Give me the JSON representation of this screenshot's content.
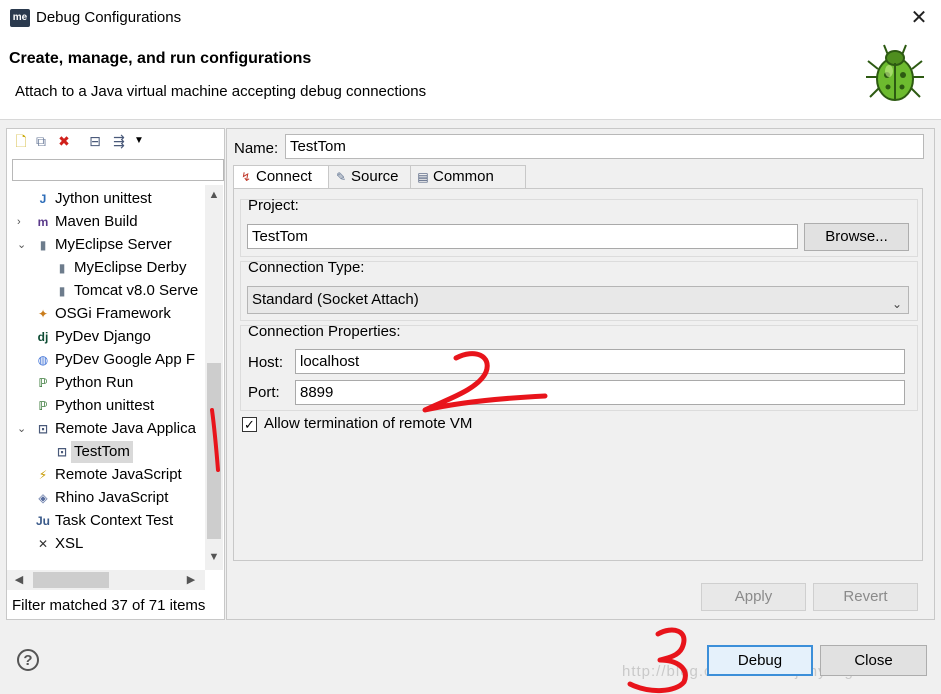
{
  "window": {
    "logo_text": "me",
    "title": "Debug Configurations",
    "close_glyph": "✕"
  },
  "banner": {
    "title": "Create, manage, and run configurations",
    "message": "Attach to a Java virtual machine accepting debug connections",
    "icon": "bug-icon"
  },
  "left": {
    "toolbar_icons": [
      "new-config-icon",
      "duplicate-icon",
      "delete-icon",
      "collapse-all-icon",
      "filter-icon",
      "dropdown-icon"
    ],
    "filter_placeholder": "",
    "tree": [
      {
        "label": "Jython unittest",
        "level": 1,
        "expander": "",
        "icon": "jython-icon"
      },
      {
        "label": "Maven Build",
        "level": 1,
        "expander": "›",
        "icon": "maven-icon"
      },
      {
        "label": "MyEclipse Server",
        "level": 1,
        "expander": "⌄",
        "icon": "server-icon"
      },
      {
        "label": "MyEclipse Derby",
        "level": 2,
        "expander": "",
        "icon": "server-icon"
      },
      {
        "label": "Tomcat v8.0 Serve",
        "level": 2,
        "expander": "",
        "icon": "server-icon"
      },
      {
        "label": "OSGi Framework",
        "level": 1,
        "expander": "",
        "icon": "osgi-icon"
      },
      {
        "label": "PyDev Django",
        "level": 1,
        "expander": "",
        "icon": "django-icon"
      },
      {
        "label": "PyDev Google App F",
        "level": 1,
        "expander": "",
        "icon": "google-app-icon"
      },
      {
        "label": "Python Run",
        "level": 1,
        "expander": "",
        "icon": "python-icon"
      },
      {
        "label": "Python unittest",
        "level": 1,
        "expander": "",
        "icon": "python-unittest-icon"
      },
      {
        "label": "Remote Java Applica",
        "level": 1,
        "expander": "⌄",
        "icon": "remote-java-icon"
      },
      {
        "label": "TestTom",
        "level": 2,
        "expander": "",
        "icon": "remote-java-icon",
        "selected": true
      },
      {
        "label": "Remote JavaScript",
        "level": 1,
        "expander": "",
        "icon": "remote-js-icon"
      },
      {
        "label": "Rhino JavaScript",
        "level": 1,
        "expander": "",
        "icon": "rhino-icon"
      },
      {
        "label": "Task Context Test",
        "level": 1,
        "expander": "",
        "icon": "task-context-icon"
      },
      {
        "label": "XSL",
        "level": 1,
        "expander": "",
        "icon": "xsl-icon"
      }
    ],
    "filter_status": "Filter matched 37 of 71 items"
  },
  "right": {
    "name_label": "Name:",
    "name_value": "TestTom",
    "tabs": [
      {
        "label": "Connect",
        "icon": "connect-icon",
        "active": true
      },
      {
        "label": "Source",
        "icon": "source-icon",
        "active": false
      },
      {
        "label": "Common",
        "icon": "common-icon",
        "active": false
      }
    ],
    "project_label": "Project:",
    "project_value": "TestTom",
    "browse_label": "Browse...",
    "connection_type_label": "Connection Type:",
    "connection_type_value": "Standard (Socket Attach)",
    "connection_props_label": "Connection Properties:",
    "host_label": "Host:",
    "host_value": "localhost",
    "port_label": "Port:",
    "port_value": "8899",
    "allow_termination_label": "Allow termination of remote VM",
    "allow_termination_checked": true,
    "apply_label": "Apply",
    "revert_label": "Revert"
  },
  "bottom": {
    "help_glyph": "?",
    "debug_label": "Debug",
    "close_label": "Close",
    "watermark": "http://blog.csdn.net/wujunyucg"
  },
  "annotations": {
    "mark1": "1",
    "mark2": "2",
    "mark3": "3",
    "color": "#e8141b"
  }
}
